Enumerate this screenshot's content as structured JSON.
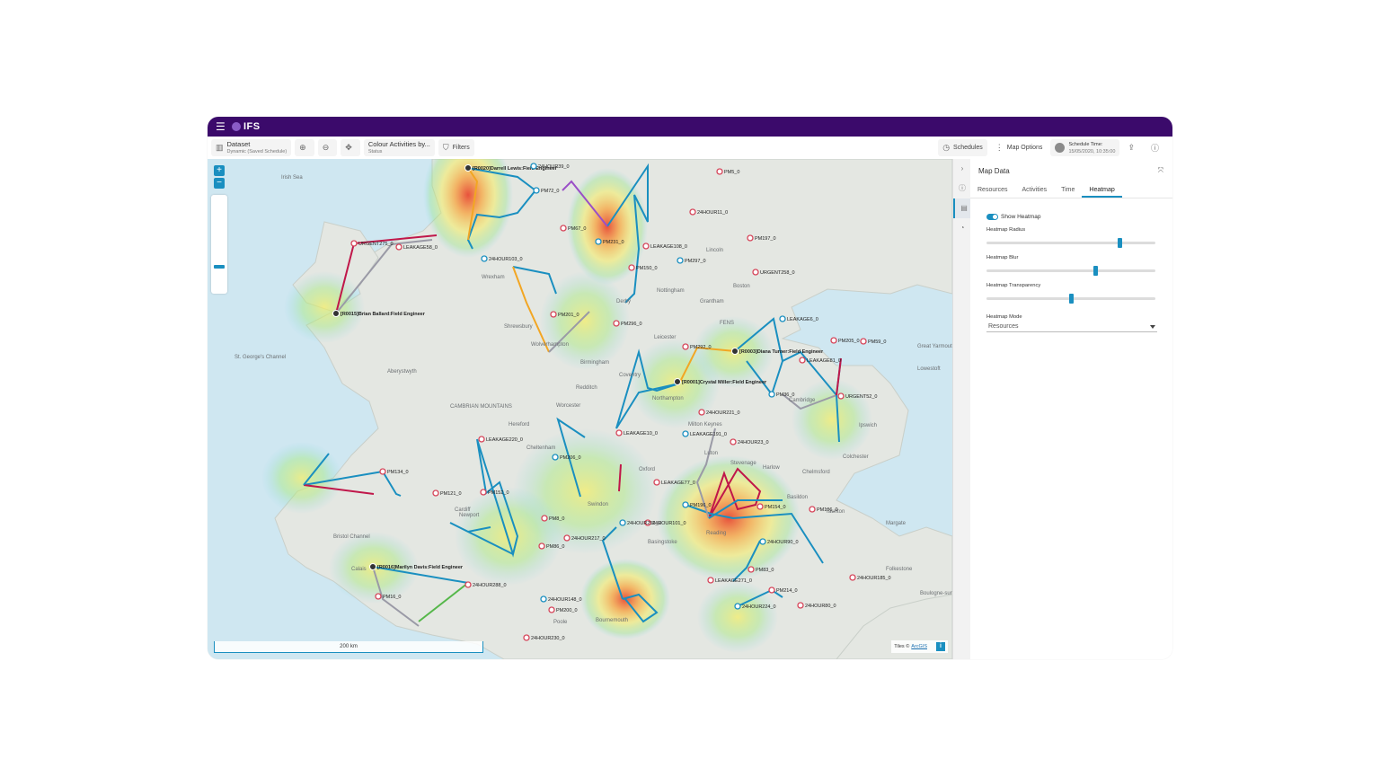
{
  "brand": {
    "name": "IFS"
  },
  "toolbar": {
    "dataset_title": "Dataset",
    "dataset_sub": "Dynamic (Saved Schedule)",
    "colour_title": "Colour Activities by...",
    "colour_sub": "Status",
    "filters": "Filters",
    "schedules": "Schedules",
    "map_options": "Map Options",
    "schedule_time_title": "Schedule Time:",
    "schedule_time_value": "15/05/2020, 10:35:00"
  },
  "map": {
    "scale_label": "200 km",
    "attribution_prefix": "Tiles ©",
    "attribution_link": "ArcGIS",
    "place_labels": [
      "Irish Sea",
      "St. George's Channel",
      "Aberystwyth",
      "Cardiff",
      "Bristol Channel",
      "Birmingham",
      "Coventry",
      "Leicester",
      "Nottingham",
      "Derby",
      "Wrexham",
      "Shrewsbury",
      "Wolverhampton",
      "Lincoln",
      "Boston",
      "Grantham",
      "Cambridge",
      "Ipswich",
      "Colchester",
      "Chelmsford",
      "Oxford",
      "Swindon",
      "Reading",
      "Basingstoke",
      "Margate",
      "Folkestone",
      "Poole",
      "Bournemouth",
      "FENS",
      "CAMBRIAN MOUNTAINS",
      "Great Yarmouth",
      "Lowestoft",
      "Hereford",
      "Cheltenham",
      "Worcester",
      "Redditch",
      "Newport",
      "Northampton",
      "Milton Keynes",
      "Luton",
      "Stevenage",
      "Harlow",
      "Basildon",
      "Taunton",
      "Calais",
      "Boulogne-sur-Mer"
    ],
    "resource_labels": [
      "[R0020]Darrell Lewis:Field Engineer",
      "[R0015]Brian Ballard:Field Engineer",
      "[R0001]Crystal Miller:Field Engineer",
      "[R0003]Diana Turner:Field Engineer",
      "[R0016]Marilyn Davis:Field Engineer"
    ],
    "activity_labels": [
      "24HOUR39_0",
      "PM5_0",
      "24HOUR11_0",
      "PM67_0",
      "PM231_0",
      "LEAKAGE108_0",
      "PM197_0",
      "PM150_0",
      "PM297_0",
      "URGENT258_0",
      "URGENT275_0",
      "LEAKAGE58_0",
      "24HOUR103_0",
      "PM201_0",
      "PM296_0",
      "PM292_0",
      "LEAKAGE6_0",
      "PM205_0",
      "PM59_0",
      "LEAKAGE81_0",
      "PM36_0",
      "URGENT52_0",
      "24HOUR221_0",
      "LEAKAGE10_0",
      "LEAKAGE191_0",
      "24HOUR23_0",
      "LEAKAGE220_0",
      "PM134_0",
      "PM206_0",
      "PM121_0",
      "PM152_0",
      "LEAKAGE77_0",
      "PM196_0",
      "PM154_0",
      "24HOUR101_0",
      "PM8_0",
      "24HOUR256_0",
      "PM106_0",
      "PM86_0",
      "24HOUR217_0",
      "24HOUR90_0",
      "PM83_0",
      "24HOUR288_0",
      "PM16_0",
      "24HOUR148_0",
      "PM200_0",
      "LEAKAGE271_0",
      "PM214_0",
      "24HOUR224_0",
      "24HOUR80_0",
      "24HOUR185_0",
      "24HOUR230_0",
      "PM72_0"
    ]
  },
  "panel": {
    "title": "Map Data",
    "tabs": [
      "Resources",
      "Activities",
      "Time",
      "Heatmap"
    ],
    "active_tab": "Heatmap",
    "show_heatmap_label": "Show Heatmap",
    "show_heatmap": true,
    "radius_label": "Heatmap Radius",
    "radius_value": 0.8,
    "blur_label": "Heatmap Blur",
    "blur_value": 0.65,
    "transparency_label": "Heatmap Transparency",
    "transparency_value": 0.5,
    "mode_label": "Heatmap Mode",
    "mode_value": "Resources"
  },
  "colors": {
    "topbar": "#3b0a6b",
    "accent": "#1a8fc0",
    "route_blue": "#1a8fc0",
    "route_orange": "#f2a623",
    "route_red": "#c0174a",
    "route_grey": "#9a9aa6"
  }
}
